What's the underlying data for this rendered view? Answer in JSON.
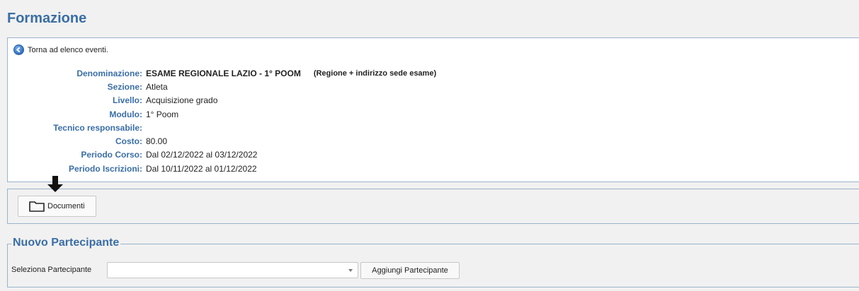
{
  "page": {
    "title": "Formazione"
  },
  "event": {
    "back_link": "Torna ad elenco eventi.",
    "details": [
      {
        "label": "Denominazione:",
        "value": "ESAME REGIONALE LAZIO - 1° POOM",
        "note": "(Regione + indirizzo sede esame)"
      },
      {
        "label": "Sezione:",
        "value": "Atleta"
      },
      {
        "label": "Livello:",
        "value": "Acquisizione grado"
      },
      {
        "label": "Modulo:",
        "value": "1° Poom"
      },
      {
        "label": "Tecnico responsabile:",
        "value": ""
      },
      {
        "label": "Costo:",
        "value": "80.00"
      },
      {
        "label": "Periodo Corso:",
        "value": "Dal 02/12/2022 al 03/12/2022"
      },
      {
        "label": "Periodo Iscrizioni:",
        "value": "Dal 10/11/2022 al 01/12/2022"
      }
    ]
  },
  "documents": {
    "button_label": "Documenti"
  },
  "new_participant": {
    "legend": "Nuovo Partecipante",
    "select_label": "Seleziona Partecipante",
    "select_value": "",
    "add_button_label": "Aggiungi Partecipante"
  },
  "icons": {
    "back": "back-arrow-circle-icon",
    "folder": "folder-icon",
    "pointer": "down-arrow-icon"
  },
  "colors": {
    "accent": "#3a6ea5",
    "border": "#9ab3cc",
    "background": "#f1f1f1"
  }
}
